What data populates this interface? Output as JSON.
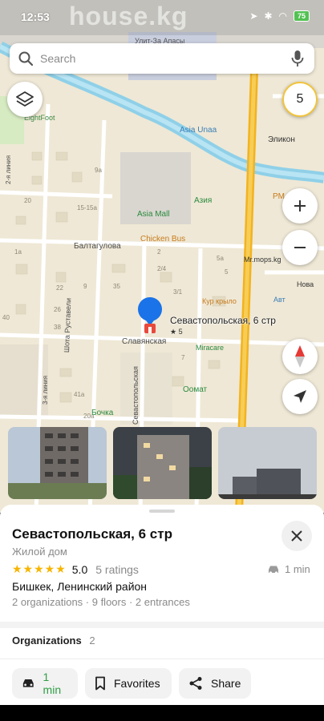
{
  "status_bar": {
    "time": "12:53",
    "watermark": "house.kg",
    "battery": "75"
  },
  "search": {
    "placeholder": "Search"
  },
  "traffic_level": "5",
  "map_labels": {
    "sign_top": "Улит-За Апасы",
    "asia_unaa": "Asia Unaa",
    "eight_foot": "EightFoot",
    "elikon": "Эликон",
    "aziya": "Азия",
    "asia_mall": "Asia Mall",
    "pm": "PM",
    "chicken_bus": "Chicken Bus",
    "baltagulova": "Балтагулова",
    "mr_mops": "Mr.mops.kg",
    "novo": "Нова",
    "kur_kryl": "Кур крыло",
    "avt": "Авт",
    "slavyanskaya": "Славянская",
    "miracare": "Miracare",
    "oomat": "Оомат",
    "bochka": "Бочка",
    "shota_rustaveli": "Шота Руставели",
    "sevastopolskaya_street": "Севастопольская",
    "line_2": "2-я линия",
    "line_3": "3-я линия"
  },
  "map_numbers": [
    "9а",
    "20",
    "15-15а",
    "2/4",
    "3/1",
    "5а",
    "5",
    "9",
    "38",
    "22",
    "26",
    "40",
    "2",
    "7",
    "41а",
    "35",
    "1а",
    "20а"
  ],
  "pin": {
    "label": "Севастопольская, 6 стр",
    "rating": "★ 5"
  },
  "place": {
    "title": "Севастопольская, 6 стр",
    "type": "Жилой дом",
    "stars": "★★★★★",
    "rating": "5.0",
    "ratings_count": "5 ratings",
    "drive_time": "1 min",
    "address": "Бишкек, Ленинский район",
    "details": "2 organizations · 9 floors · 2 entrances",
    "organizations_label": "Organizations",
    "organizations_count": "2"
  },
  "actions": {
    "route": "1 min",
    "favorites": "Favorites",
    "share": "Share"
  },
  "colors": {
    "accent_blue": "#1a73e8",
    "pin_red": "#e84a3c",
    "star_yellow": "#f7b500",
    "route_green": "#2f9e44",
    "road_yellow": "#f2b320"
  }
}
